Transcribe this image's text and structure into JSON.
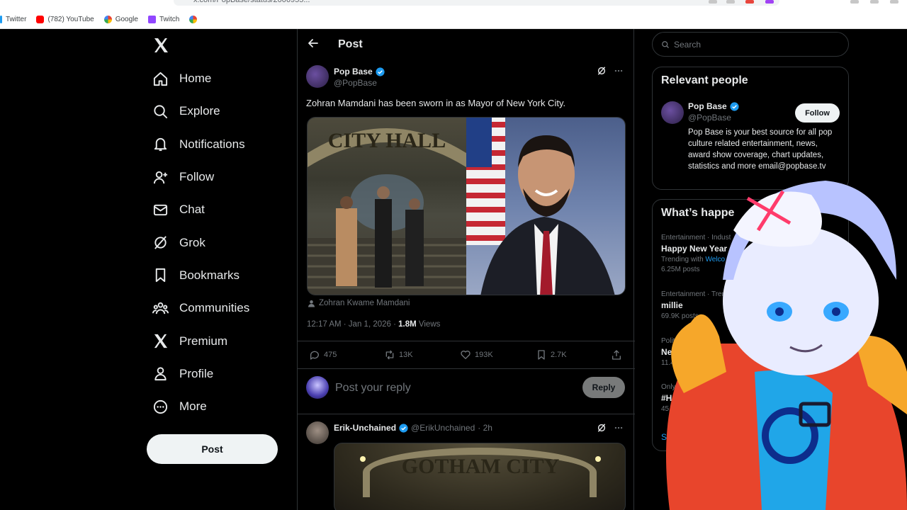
{
  "browser": {
    "url": "x.com/PopBase/status/2006955...",
    "bookmarks": [
      {
        "label": "Twitter",
        "color": "#1d9bf0"
      },
      {
        "label": "(782) YouTube",
        "color": "#ff0000"
      },
      {
        "label": "Google",
        "color": "#4285f4"
      },
      {
        "label": "Twitch",
        "color": "#9146ff"
      },
      {
        "label": "",
        "color": "#4285f4"
      }
    ]
  },
  "nav": {
    "items": [
      {
        "label": "Home",
        "icon": "home-icon"
      },
      {
        "label": "Explore",
        "icon": "search-icon"
      },
      {
        "label": "Notifications",
        "icon": "bell-icon"
      },
      {
        "label": "Follow",
        "icon": "follow-icon"
      },
      {
        "label": "Chat",
        "icon": "mail-icon"
      },
      {
        "label": "Grok",
        "icon": "grok-icon"
      },
      {
        "label": "Bookmarks",
        "icon": "bookmark-icon"
      },
      {
        "label": "Communities",
        "icon": "communities-icon"
      },
      {
        "label": "Premium",
        "icon": "x-icon"
      },
      {
        "label": "Profile",
        "icon": "profile-icon"
      },
      {
        "label": "More",
        "icon": "more-icon"
      }
    ],
    "post_label": "Post"
  },
  "main": {
    "header_title": "Post",
    "tweet": {
      "author_name": "Pop Base",
      "author_handle": "@PopBase",
      "text": "Zohran Mamdani has been sworn in as Mayor of New York City.",
      "tagged": "Zohran Kwame Mamdani",
      "time": "12:17 AM · Jan 1, 2026 · ",
      "views_count": "1.8M",
      "views_label": " Views",
      "replies": "475",
      "reposts": "13K",
      "likes": "193K",
      "bookmarks": "2.7K",
      "media_sign": "CITY HALL"
    },
    "reply_placeholder": "Post your reply",
    "reply_button": "Reply",
    "reply2": {
      "author_name": "Erik-Unchained",
      "author_handle": "@ErikUnchained",
      "time": "· 2h",
      "media_sign": "GOTHAM CITY"
    }
  },
  "right": {
    "search_placeholder": "Search",
    "relevant_title": "Relevant people",
    "person": {
      "name": "Pop Base",
      "handle": "@PopBase",
      "follow_label": "Follow",
      "bio": "Pop Base is your best source for all pop culture related entertainment, news, award show coverage, chart updates, statistics and more email@popbase.tv"
    },
    "happening_title": "What’s happe",
    "trends": [
      {
        "category": "Entertainment · Indust",
        "name": "Happy New Year",
        "sub_prefix": "Trending with ",
        "sub_link": "Welco"
      },
      {
        "category": "Entertainment · Trending",
        "name": "millie",
        "sub_prefix": "69.9K posts",
        "sub_link": ""
      },
      {
        "category": "Politics · Trend",
        "name": "New Y",
        "sub_prefix": "11.4K po",
        "sub_link": ""
      },
      {
        "category": "Only on",
        "name": "#Holin",
        "sub_prefix": "45.3K po",
        "sub_link": ""
      }
    ],
    "trend0_posts": "6.25M posts",
    "show_more": "Sho"
  }
}
